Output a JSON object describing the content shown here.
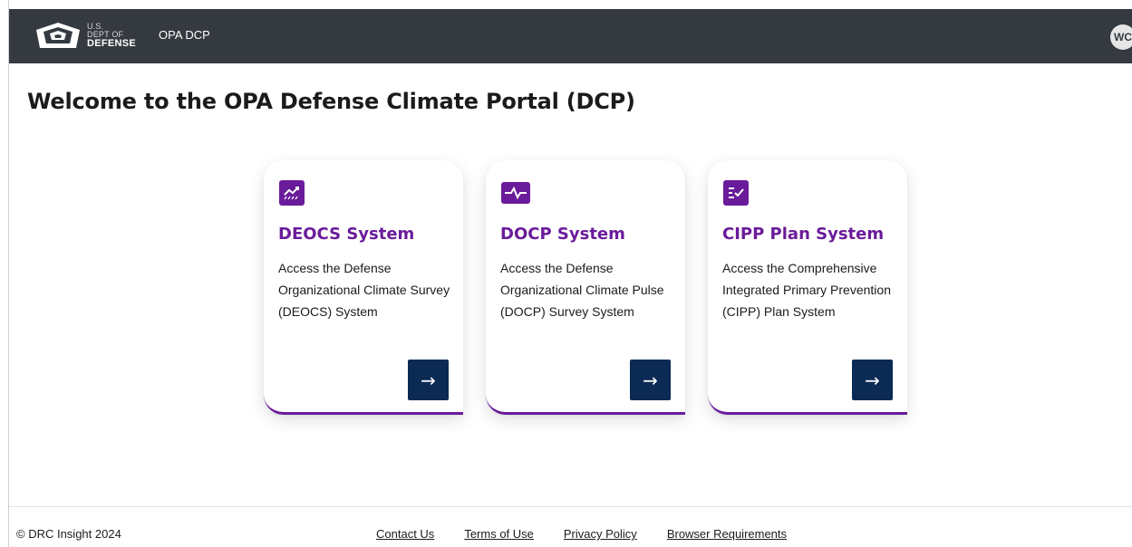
{
  "header": {
    "seal_line1": "U.S.",
    "seal_line2": "DEPT OF",
    "seal_line3": "DEFENSE",
    "app_name": "OPA DCP",
    "avatar_initials": "WC",
    "background": "#343a40"
  },
  "main": {
    "title": "Welcome to the OPA Defense Climate Portal (DCP)",
    "accent_color": "#6a1b9a",
    "button_color": "#0b2a54",
    "cards": [
      {
        "icon": "chart-trend-icon",
        "title": "DEOCS System",
        "description": "Access the Defense Organizational Climate Survey (DEOCS) System",
        "button_icon": "arrow-right-icon"
      },
      {
        "icon": "pulse-icon",
        "title": "DOCP System",
        "description": "Access the Defense Organizational Climate Pulse (DOCP) Survey System",
        "button_icon": "arrow-right-icon"
      },
      {
        "icon": "checklist-icon",
        "title": "CIPP Plan System",
        "description": "Access the Comprehensive Integrated Primary Prevention (CIPP) Plan System",
        "button_icon": "arrow-right-icon"
      }
    ]
  },
  "footer": {
    "copyright": "© DRC Insight 2024",
    "links": [
      "Contact Us",
      "Terms of Use",
      "Privacy Policy",
      "Browser Requirements"
    ]
  }
}
